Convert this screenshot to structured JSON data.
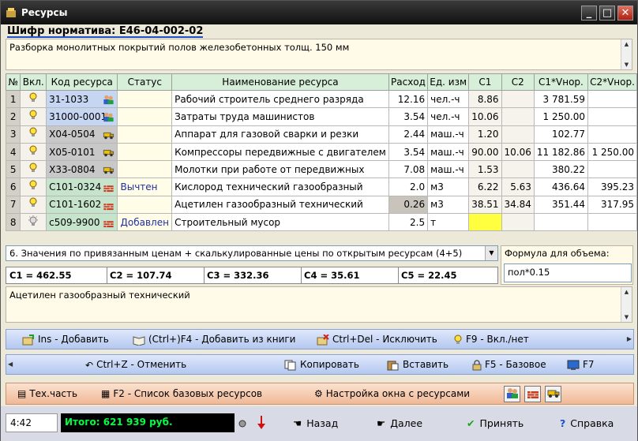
{
  "window": {
    "title": "Ресурсы"
  },
  "shifr": "Шифр норматива: Е46-04-002-02",
  "description": "Разборка монолитных покрытий полов железобетонных  толщ. 150 мм",
  "table": {
    "headers": [
      "№",
      "Вкл.",
      "Код ресурса",
      "Статус",
      "Наименование ресурса",
      "Расход",
      "Ед. изм",
      "C1",
      "C2",
      "C1*Vнор.",
      "C2*Vнор."
    ],
    "rows": [
      {
        "n": "1",
        "code": "31-1033",
        "status": "",
        "name": "Рабочий строитель среднего разряда",
        "rashod": "12.16",
        "unit": "чел.-ч",
        "c1": "8.86",
        "c2": "",
        "c1v": "3 781.59",
        "c2v": "",
        "color": "blue",
        "icon": "people"
      },
      {
        "n": "2",
        "code": "31000-0001",
        "status": "",
        "name": "Затраты труда машинистов",
        "rashod": "3.54",
        "unit": "чел.-ч",
        "c1": "10.06",
        "c2": "",
        "c1v": "1 250.00",
        "c2v": "",
        "color": "blue",
        "icon": "people"
      },
      {
        "n": "3",
        "code": "X04-0504",
        "status": "",
        "name": "Аппарат для газовой сварки и резки",
        "rashod": "2.44",
        "unit": "маш.-ч",
        "c1": "1.20",
        "c2": "",
        "c1v": "102.77",
        "c2v": "",
        "color": "grey",
        "icon": "truck"
      },
      {
        "n": "4",
        "code": "X05-0101",
        "status": "",
        "name": "Компрессоры передвижные с двигателем",
        "rashod": "3.54",
        "unit": "маш.-ч",
        "c1": "90.00",
        "c2": "10.06",
        "c1v": "11 182.86",
        "c2v": "1 250.00",
        "color": "grey",
        "icon": "truck"
      },
      {
        "n": "5",
        "code": "X33-0804",
        "status": "",
        "name": "Молотки при работе от передвижных",
        "rashod": "7.08",
        "unit": "маш.-ч",
        "c1": "1.53",
        "c2": "",
        "c1v": "380.22",
        "c2v": "",
        "color": "grey",
        "icon": "truck"
      },
      {
        "n": "6",
        "code": "C101-0324",
        "status": "Вычтен",
        "name": "Кислород технический газообразный",
        "rashod": "2.0",
        "unit": "м3",
        "c1": "6.22",
        "c2": "5.63",
        "c1v": "436.64",
        "c2v": "395.23",
        "color": "green",
        "icon": "bricks"
      },
      {
        "n": "7",
        "code": "C101-1602",
        "status": "",
        "name": "Ацетилен газообразный технический",
        "rashod": "0.26",
        "unit": "м3",
        "c1": "38.51",
        "c2": "34.84",
        "c1v": "351.44",
        "c2v": "317.95",
        "color": "green",
        "icon": "bricks"
      },
      {
        "n": "8",
        "code": "c509-9900",
        "status": "Добавлен",
        "name": "Строительный мусор",
        "rashod": "2.5",
        "unit": "т",
        "c1": "",
        "c2": "",
        "c1v": "",
        "c2v": "",
        "color": "green",
        "icon": "bricks"
      }
    ]
  },
  "combo": "6. Значения по привязанным ценам + скалькулированные цены по открытым ресурсам (4+5)",
  "cvalues": [
    "C1 = 462.55",
    "C2 = 107.74",
    "C3 = 332.36",
    "C4 = 35.61",
    "C5 = 22.45"
  ],
  "formula": {
    "label": "Формула для объема:",
    "value": "пол*0.15"
  },
  "note": "Ацетилен газообразный технический",
  "toolbar1": [
    "Ins - Добавить",
    "(Ctrl+)F4 - Добавить из книги",
    "Ctrl+Del - Исключить",
    "F9 - Вкл./нет"
  ],
  "toolbar2": [
    "Ctrl+Z - Отменить",
    "Копировать",
    "Вставить",
    "F5 - Базовое",
    "F7"
  ],
  "toolbar3": [
    "Тех.часть",
    "F2 - Список базовых ресурсов",
    "Настройка окна с ресурсами"
  ],
  "bottom": {
    "time": "4:42",
    "total": "Итого: 621 939 руб.",
    "back": "Назад",
    "next": "Далее",
    "accept": "Принять",
    "help": "Справка"
  },
  "colors": {
    "title_bar": "#1a1a1a",
    "total_text": "#00ff40",
    "status_text": "#2030a0"
  }
}
